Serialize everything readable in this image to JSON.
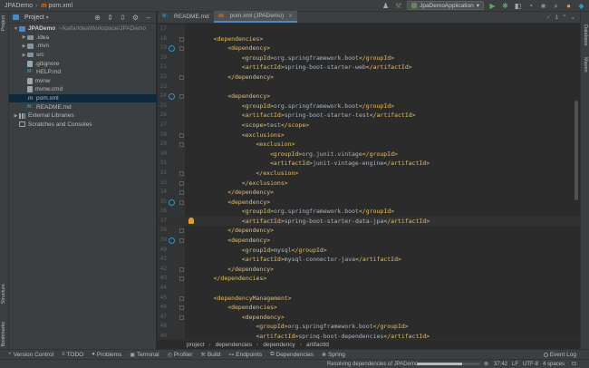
{
  "navbar": {
    "project": "JPADemo",
    "file": "pom.xml",
    "run_config": "JpaDemoApplication"
  },
  "left_stripe": {
    "top": "Project",
    "structure": "Structure",
    "bookmarks": "Bookmarks"
  },
  "right_stripe": {
    "database": "Database",
    "maven": "Maven"
  },
  "project_panel": {
    "title": "Project",
    "tree": [
      {
        "name": "JPADemo",
        "path": "~/kaifa/IdeaWorkspace/JPADemo",
        "type": "root",
        "indent": 0,
        "arrow": "▼"
      },
      {
        "name": ".idea",
        "type": "folder",
        "indent": 1,
        "arrow": "▶"
      },
      {
        "name": ".mvn",
        "type": "folder",
        "indent": 1,
        "arrow": "▶"
      },
      {
        "name": "src",
        "type": "folder",
        "indent": 1,
        "arrow": "▶"
      },
      {
        "name": ".gitignore",
        "type": "file",
        "indent": 1,
        "arrow": ""
      },
      {
        "name": "HELP.md",
        "type": "md",
        "indent": 1,
        "arrow": ""
      },
      {
        "name": "mvnw",
        "type": "file",
        "indent": 1,
        "arrow": ""
      },
      {
        "name": "mvnw.cmd",
        "type": "file",
        "indent": 1,
        "arrow": ""
      },
      {
        "name": "pom.xml",
        "type": "maven",
        "indent": 1,
        "arrow": "",
        "selected": true
      },
      {
        "name": "README.md",
        "type": "md",
        "indent": 1,
        "arrow": ""
      },
      {
        "name": "External Libraries",
        "type": "lib",
        "indent": 0,
        "arrow": "▶"
      },
      {
        "name": "Scratches and Consoles",
        "type": "scratch",
        "indent": 0,
        "arrow": ""
      }
    ]
  },
  "editor": {
    "tabs": [
      {
        "label": "README.md",
        "icon": "md",
        "active": false
      },
      {
        "label": "pom.xml (JPADemo)",
        "icon": "maven",
        "active": true
      }
    ],
    "inspection_count": "1",
    "lines": [
      {
        "n": "17",
        "tag": "",
        "indent": 0
      },
      {
        "n": "18",
        "tag": "<dependencies>",
        "indent": 1,
        "fold": true
      },
      {
        "n": "19",
        "tag": "<dependency>",
        "indent": 2,
        "fold": true,
        "marker": true
      },
      {
        "n": "20",
        "open": "<groupId>",
        "val": "org.springframework.boot",
        "close": "</groupId>",
        "indent": 3
      },
      {
        "n": "21",
        "open": "<artifactId>",
        "val": "spring-boot-starter-web",
        "close": "</artifactId>",
        "indent": 3
      },
      {
        "n": "22",
        "tag": "</dependency>",
        "indent": 2,
        "fold": true
      },
      {
        "n": "23",
        "tag": "",
        "indent": 0
      },
      {
        "n": "24",
        "tag": "<dependency>",
        "indent": 2,
        "fold": true,
        "marker": true
      },
      {
        "n": "25",
        "open": "<groupId>",
        "val": "org.springframework.boot",
        "close": "</groupId>",
        "indent": 3
      },
      {
        "n": "26",
        "open": "<artifactId>",
        "val": "spring-boot-starter-test",
        "close": "</artifactId>",
        "indent": 3
      },
      {
        "n": "27",
        "open": "<scope>",
        "val": "test",
        "close": "</scope>",
        "indent": 3
      },
      {
        "n": "28",
        "tag": "<exclusions>",
        "indent": 3,
        "fold": true
      },
      {
        "n": "29",
        "tag": "<exclusion>",
        "indent": 4,
        "fold": true
      },
      {
        "n": "30",
        "open": "<groupId>",
        "val": "org.junit.vintage",
        "close": "</groupId>",
        "indent": 5
      },
      {
        "n": "31",
        "open": "<artifactId>",
        "val": "junit-vintage-engine",
        "close": "</artifactId>",
        "indent": 5
      },
      {
        "n": "32",
        "tag": "</exclusion>",
        "indent": 4,
        "fold": true
      },
      {
        "n": "33",
        "tag": "</exclusions>",
        "indent": 3,
        "fold": true
      },
      {
        "n": "34",
        "tag": "</dependency>",
        "indent": 2,
        "fold": true
      },
      {
        "n": "35",
        "tag": "<dependency>",
        "indent": 2,
        "fold": true,
        "marker": true
      },
      {
        "n": "36",
        "open": "<groupId>",
        "val": "org.springframework.boot",
        "close": "</groupId>",
        "indent": 3
      },
      {
        "n": "37",
        "open": "<artifactId>",
        "val": "spring-boot-starter-data-jpa",
        "close": "</artifactId>",
        "indent": 3,
        "current": true,
        "bulb": true
      },
      {
        "n": "38",
        "tag": "</dependency>",
        "indent": 2,
        "fold": true
      },
      {
        "n": "39",
        "tag": "<dependency>",
        "indent": 2,
        "fold": true,
        "marker": true
      },
      {
        "n": "40",
        "open": "<groupId>",
        "val": "mysql",
        "close": "</groupId>",
        "indent": 3
      },
      {
        "n": "41",
        "open": "<artifactId>",
        "val": "mysql-connector-java",
        "close": "</artifactId>",
        "indent": 3
      },
      {
        "n": "42",
        "tag": "</dependency>",
        "indent": 2,
        "fold": true
      },
      {
        "n": "43",
        "tag": "</dependencies>",
        "indent": 1,
        "fold": true
      },
      {
        "n": "44",
        "tag": "",
        "indent": 0
      },
      {
        "n": "45",
        "tag": "<dependencyManagement>",
        "indent": 1,
        "fold": true
      },
      {
        "n": "46",
        "tag": "<dependencies>",
        "indent": 2,
        "fold": true
      },
      {
        "n": "47",
        "tag": "<dependency>",
        "indent": 3,
        "fold": true
      },
      {
        "n": "48",
        "open": "<groupId>",
        "val": "org.springframework.boot",
        "close": "</groupId>",
        "indent": 4
      },
      {
        "n": "49",
        "open": "<artifactId>",
        "val": "spring-boot-dependencies",
        "close": "</artifactId>",
        "indent": 4
      }
    ],
    "breadcrumbs": [
      "project",
      "dependencies",
      "dependency",
      "artifactId"
    ]
  },
  "tool_windows": [
    {
      "label": "Version Control",
      "icon": "branch-icon"
    },
    {
      "label": "TODO",
      "icon": "list-icon"
    },
    {
      "label": "Problems",
      "icon": "problems-icon"
    },
    {
      "label": "Terminal",
      "icon": "terminal-icon"
    },
    {
      "label": "Profiler",
      "icon": "profiler-icon"
    },
    {
      "label": "Build",
      "icon": "hammer-icon"
    },
    {
      "label": "Endpoints",
      "icon": "endpoints-icon"
    },
    {
      "label": "Dependencies",
      "icon": "dependencies-icon"
    },
    {
      "label": "Spring",
      "icon": "spring-icon"
    }
  ],
  "event_log": "Event Log",
  "status": {
    "message": "Resolving dependencies of JPADemo...",
    "progress": 0.72,
    "position": "37:42",
    "line_sep": "LF",
    "encoding": "UTF-8",
    "indent": "4 spaces"
  }
}
